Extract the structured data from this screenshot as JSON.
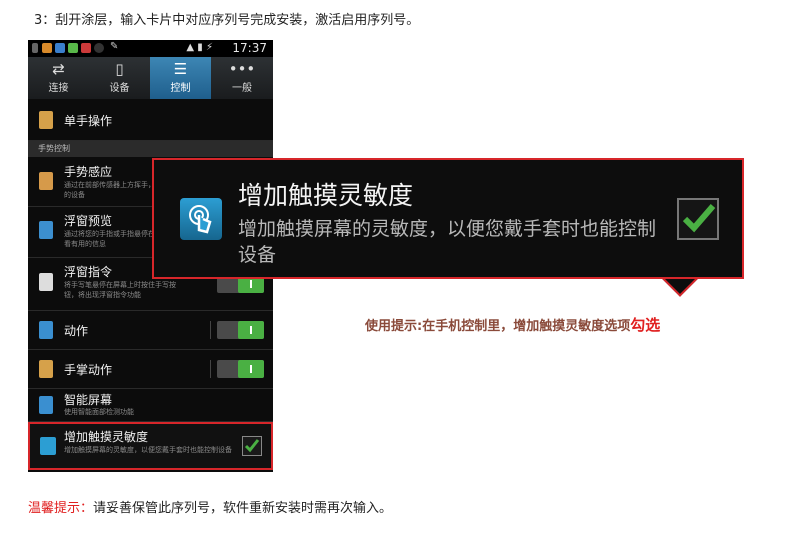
{
  "instruction": "3：刮开涂层，输入卡片中对应序列号完成安装，激活启用序列号。",
  "phone": {
    "status": {
      "time": "17:37"
    },
    "tabs": [
      {
        "label": "连接",
        "icon": "arrows-icon"
      },
      {
        "label": "设备",
        "icon": "phone-icon"
      },
      {
        "label": "控制",
        "icon": "sliders-icon"
      },
      {
        "label": "一般",
        "icon": "dots-icon"
      }
    ],
    "one_hand": "单手操作",
    "section_header": "手势控制",
    "rows": [
      {
        "title": "手势感应",
        "subtitle": "通过在前部传感器上方挥手，以控制您的设备"
      },
      {
        "title": "浮窗预览",
        "subtitle": "通过将您的手指或手指悬停在屏幕上查看有用的信息"
      },
      {
        "title": "浮窗指令",
        "subtitle": "将手写笔悬停在屏幕上时按住手写按钮，将出现浮窗指令功能"
      },
      {
        "title": "动作",
        "subtitle": ""
      },
      {
        "title": "手掌动作",
        "subtitle": ""
      },
      {
        "title": "智能屏幕",
        "subtitle": "使用智能面部检测功能"
      }
    ],
    "highlight": {
      "title": "增加触摸灵敏度",
      "subtitle": "增加触摸屏幕的灵敏度，以便您戴手套时也能控制设备"
    }
  },
  "callout": {
    "title": "增加触摸灵敏度",
    "desc": "增加触摸屏幕的灵敏度，以便您戴手套时也能控制设备"
  },
  "tip": {
    "text": "使用提示:在手机控制里，增加触摸灵敏度选项",
    "emph": "勾选"
  },
  "note": {
    "warm": "温馨提示：",
    "text": "请妥善保管此序列号，软件重新安装时需再次输入。"
  },
  "colors": {
    "accent": "#d7262a",
    "switch_on": "#4ab043",
    "tab_active": "#2f78a8"
  }
}
